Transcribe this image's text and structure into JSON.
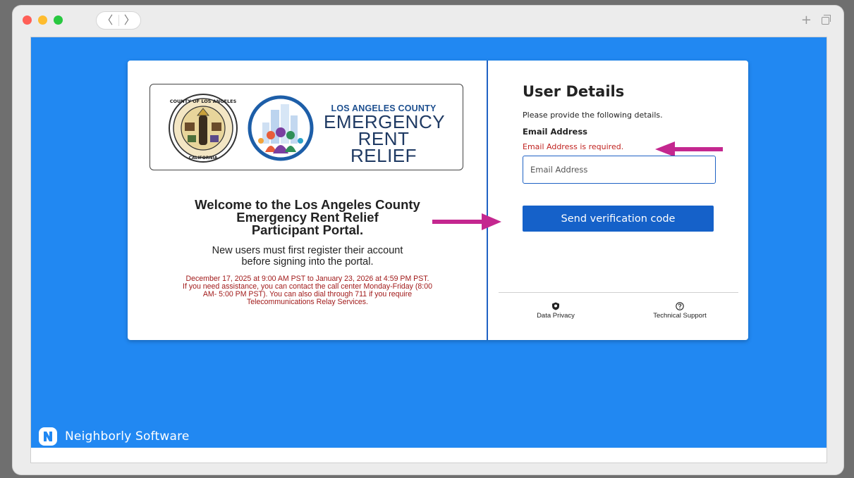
{
  "browser": {
    "back_glyph": "〈",
    "forward_glyph": "〉",
    "new_tab_glyph": "+"
  },
  "logo": {
    "small": "LOS ANGELES COUNTY",
    "line1": "EMERGENCY",
    "line2": "RENT RELIEF",
    "seal_text_top": "COUNTY OF LOS ANGELES",
    "seal_text_bottom": "CALIFORNIA"
  },
  "welcome": {
    "line1": "Welcome to the Los Angeles County",
    "line2": "Emergency Rent Relief",
    "line3": "Participant Portal."
  },
  "register": {
    "line1": "New users must first register their account",
    "line2": "before signing into the portal."
  },
  "notice": {
    "line1": "December 17, 2025 at 9:00 AM PST to January 23, 2026 at 4:59 PM PST.",
    "line2": "If you need assistance, you can contact the call center Monday-Friday (8:00",
    "line3": "AM- 5:00 PM PST). You can also dial through 711 if you require",
    "line4": "Telecommunications Relay Services."
  },
  "form": {
    "title": "User Details",
    "subtitle": "Please provide the following details.",
    "email_label": "Email Address",
    "email_error": "Email Address is required.",
    "email_placeholder": "Email Address",
    "email_value": "",
    "submit_label": "Send verification code"
  },
  "footer": {
    "privacy_label": "Data Privacy",
    "support_label": "Technical Support"
  },
  "brand": {
    "name": "Neighborly Software"
  },
  "colors": {
    "page_blue": "#2188f2",
    "button_blue": "#1561c9",
    "error_red": "#c0221f",
    "arrow_magenta": "#c4278f"
  }
}
